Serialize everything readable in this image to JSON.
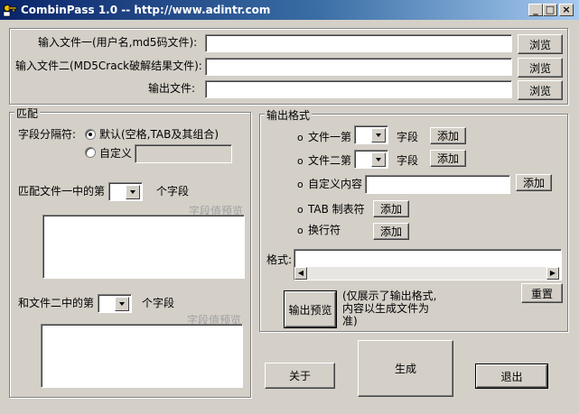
{
  "window": {
    "title": "CombinPass 1.0 -- http://www.adintr.com",
    "minimize_glyph": "_",
    "maximize_glyph": "□",
    "close_glyph": "×"
  },
  "files": {
    "input1_label": "输入文件一(用户名,md5码文件):",
    "input2_label": "输入文件二(MD5Crack破解结果文件):",
    "output_label": "输出文件:",
    "input1_value": "",
    "input2_value": "",
    "output_value": "",
    "browse_label": "浏览"
  },
  "match": {
    "title": "匹配",
    "separator_label": "字段分隔符:",
    "default_option": "默认(空格,TAB及其组合)",
    "custom_option": "自定义",
    "custom_value": "",
    "file1_field_prefix": "匹配文件一中的第",
    "file1_field_suffix": "个字段",
    "file2_field_prefix": "和文件二中的第",
    "file2_field_suffix": "个字段",
    "preview_hint": "字段值预览"
  },
  "output_format": {
    "title": "输出格式",
    "bullet": "o",
    "file1_field_label": "文件一第",
    "file2_field_label": "文件二第",
    "field_unit": "字段",
    "custom_content_label": "自定义内容",
    "tab_label": "TAB 制表符",
    "newline_label": "换行符",
    "add_label": "添加",
    "format_label": "格式:",
    "format_value": "",
    "reset_label": "重置",
    "preview_button": "输出预览",
    "preview_note": "(仅展示了输出格式,\n内容以生成文件为\n准)",
    "left_arrow": "◀",
    "right_arrow": "▶"
  },
  "actions": {
    "about": "关于",
    "generate": "生成",
    "exit": "退出"
  },
  "colors": {
    "face": "#d4d0c8",
    "titlebar_start": "#0a246a",
    "titlebar_end": "#a6caf0"
  }
}
